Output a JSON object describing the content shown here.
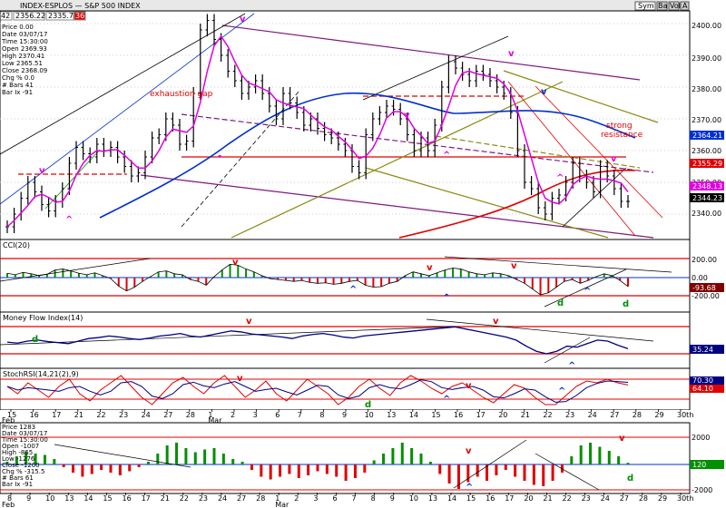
{
  "window": {
    "title": "INDEX-ESPLOS — S&P 500 INDEX",
    "symbol_field": "Sym",
    "buttons": [
      "Ba",
      "Vol",
      "A"
    ],
    "ticker_fields": [
      "42",
      "2356.22",
      "2335.74",
      "36"
    ]
  },
  "colors": {
    "magenta": "#e000e0",
    "blue": "#0030d0",
    "red": "#e00000",
    "olive": "#8a8a10",
    "purple": "#801880",
    "green": "#009000",
    "navy": "#000080",
    "maroon": "#800000"
  },
  "info_box": [
    "Price 0.00",
    "Date 03/07/17",
    "Time 15:30:00",
    "Open 2369.93",
    "High 2370.41",
    "Low 2365.51",
    "Close 2368.09",
    "Chg % 0.0",
    "# Bars 41",
    "Bar Ix -91"
  ],
  "info_box_bottom": [
    "Price 1283",
    "Date 03/07/17",
    "Time 15:30:00",
    "Open -1007",
    "High -865",
    "Low -1276",
    "Close -1200",
    "Chg % -315.5",
    "# Bars 61",
    "Bar Ix -91"
  ],
  "annotations": {
    "exhaustion_gap": "exhaustion gap",
    "strong_resistance_1": "strong",
    "strong_resistance_2": "resistance",
    "marks": [
      "v",
      "^",
      "v",
      "^",
      "v",
      "v",
      "^",
      "v",
      "^",
      "v"
    ]
  },
  "price_axis": {
    "labels": [
      "2400.00",
      "2390.00",
      "2380.00",
      "2370.00",
      "2360.00",
      "2350.00",
      "2340.00"
    ],
    "badges": [
      {
        "text": "2364.21",
        "bg": "#0030d0"
      },
      {
        "text": "2355.29",
        "bg": "#e00000"
      },
      {
        "text": "2348.13",
        "bg": "#e000e0"
      },
      {
        "text": "2344.23",
        "bg": "#000000"
      }
    ]
  },
  "cci": {
    "title": "CCI(20)",
    "labels": [
      "200.00",
      "0.00",
      "-200.00"
    ],
    "badge": "-93.68",
    "marks": [
      "v",
      "^",
      "v",
      "^",
      "v",
      "^",
      "d",
      "d"
    ]
  },
  "mfi": {
    "title": "Money Flow Index(14)",
    "badge": "35.24",
    "marks": [
      "d",
      "v",
      "v",
      "^"
    ]
  },
  "stoch": {
    "title": "StochRSI(14,21(2),9)",
    "badges": [
      "70.30",
      "64.10"
    ],
    "marks": [
      "v",
      "d",
      "^",
      "v",
      "^"
    ]
  },
  "bottom": {
    "labels": [
      "2000",
      "-2000"
    ],
    "badge": "120",
    "marks": [
      "v",
      "^",
      "v",
      "d"
    ]
  },
  "date_axis_top": {
    "ticks": [
      "15",
      "16",
      "17",
      "21",
      "22",
      "23",
      "24",
      "27",
      "28",
      "1",
      "2",
      "3",
      "6",
      "7",
      "8",
      "9",
      "10",
      "13",
      "14",
      "15",
      "16",
      "17",
      "20",
      "21",
      "22",
      "23",
      "24",
      "27",
      "28",
      "29",
      "30th"
    ],
    "month_labels": [
      "Feb",
      "Mar"
    ]
  },
  "date_axis_bottom": {
    "ticks": [
      "8",
      "9",
      "10",
      "13",
      "14",
      "15",
      "16",
      "17",
      "21",
      "22",
      "23",
      "24",
      "27",
      "28",
      "1",
      "2",
      "3",
      "6",
      "7",
      "8",
      "9",
      "10",
      "13",
      "14",
      "15",
      "16",
      "17",
      "20",
      "21",
      "22",
      "23",
      "24",
      "27",
      "28",
      "29",
      "30th"
    ],
    "month_labels": [
      "Feb",
      "Mar"
    ]
  },
  "chart_data": {
    "type": "bar",
    "title": "S&P 500 INDEX",
    "ylim": [
      2332,
      2404
    ],
    "close_series": [
      2336,
      2340,
      2345,
      2350,
      2347,
      2343,
      2341,
      2344,
      2348,
      2356,
      2361,
      2359,
      2358,
      2362,
      2360,
      2361,
      2358,
      2355,
      2352,
      2353,
      2358,
      2364,
      2365,
      2370,
      2368,
      2362,
      2363,
      2378,
      2398,
      2401,
      2395,
      2390,
      2385,
      2382,
      2378,
      2380,
      2382,
      2378,
      2374,
      2370,
      2378,
      2375,
      2372,
      2368,
      2370,
      2367,
      2365,
      2364,
      2362,
      2360,
      2355,
      2353,
      2365,
      2370,
      2372,
      2374,
      2373,
      2370,
      2365,
      2360,
      2364,
      2360,
      2368,
      2380,
      2388,
      2386,
      2384,
      2382,
      2385,
      2384,
      2382,
      2380,
      2378,
      2372,
      2360,
      2350,
      2348,
      2342,
      2340,
      2345,
      2346,
      2350,
      2356,
      2352,
      2350,
      2347,
      2355,
      2352,
      2348,
      2344,
      2344
    ],
    "cci_series": [
      45,
      30,
      55,
      40,
      20,
      35,
      80,
      90,
      70,
      45,
      30,
      50,
      20,
      -10,
      -90,
      -140,
      -100,
      -40,
      10,
      60,
      70,
      40,
      30,
      -20,
      -40,
      -80,
      10,
      80,
      140,
      130,
      90,
      60,
      20,
      -10,
      -20,
      -30,
      -40,
      -30,
      -50,
      -60,
      -55,
      -70,
      -60,
      -40,
      -30,
      -80,
      -100,
      -95,
      -60,
      -40,
      20,
      60,
      40,
      20,
      50,
      80,
      100,
      90,
      60,
      40,
      30,
      50,
      40,
      20,
      -20,
      -60,
      -120,
      -180,
      -160,
      -100,
      -40,
      -20,
      -60,
      -30,
      10,
      40,
      20,
      -30,
      -93
    ],
    "mfi_series": [
      48,
      46,
      50,
      52,
      49,
      47,
      45,
      50,
      55,
      57,
      60,
      58,
      55,
      53,
      56,
      60,
      62,
      65,
      60,
      58,
      62,
      66,
      70,
      68,
      64,
      62,
      60,
      58,
      55,
      60,
      63,
      65,
      62,
      58,
      56,
      60,
      62,
      64,
      66,
      68,
      70,
      72,
      74,
      76,
      78,
      74,
      70,
      66,
      62,
      58,
      52,
      40,
      30,
      25,
      30,
      40,
      38,
      45,
      52,
      50,
      42,
      35
    ],
    "stoch_series": [
      60,
      40,
      70,
      50,
      30,
      60,
      80,
      40,
      20,
      50,
      70,
      90,
      60,
      30,
      10,
      40,
      70,
      85,
      60,
      40,
      70,
      90,
      60,
      30,
      50,
      75,
      40,
      20,
      50,
      80,
      60,
      40,
      10,
      30,
      60,
      80,
      55,
      35,
      70,
      90,
      75,
      55,
      40,
      60,
      70,
      50,
      30,
      15,
      40,
      65,
      55,
      30,
      10,
      10,
      35,
      60,
      75,
      70,
      80,
      70,
      64
    ],
    "bottom_series": [
      200,
      600,
      900,
      800,
      700,
      400,
      -200,
      -600,
      -900,
      -700,
      -400,
      -600,
      -800,
      -500,
      -200,
      200,
      800,
      1400,
      1600,
      1200,
      900,
      1100,
      1200,
      800,
      400,
      200,
      -400,
      -900,
      -1100,
      -900,
      -700,
      -1000,
      -800,
      -500,
      -700,
      -900,
      -1200,
      -1000,
      -600,
      300,
      800,
      1200,
      1600,
      1200,
      800,
      200,
      -700,
      -1400,
      -1800,
      -1300,
      -900,
      -1200,
      -800,
      -400,
      -900,
      -1200,
      -1500,
      -1600,
      -1200,
      -600,
      600,
      1400,
      1600,
      1300,
      1000,
      600,
      120
    ]
  }
}
